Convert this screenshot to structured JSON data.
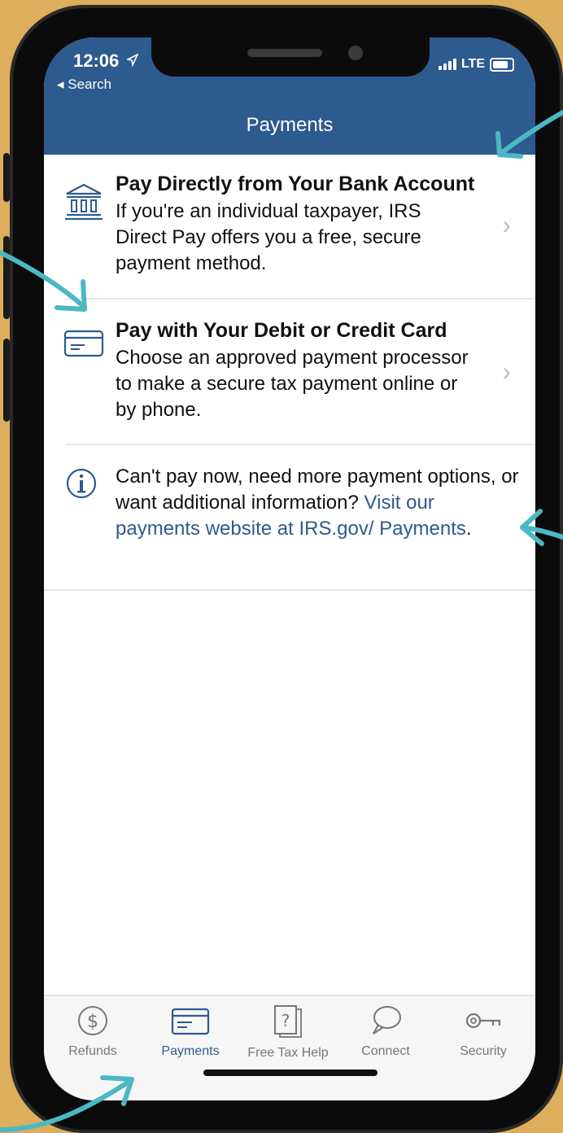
{
  "status_bar": {
    "time": "12:06",
    "location_icon": "location-arrow-icon",
    "back_label": "◂ Search",
    "network": "LTE"
  },
  "header": {
    "title": "Payments"
  },
  "rows": [
    {
      "icon": "bank-icon",
      "title": "Pay Directly from Your Bank Account",
      "description": "If you're an individual taxpayer, IRS Direct Pay offers you a free, secure payment method."
    },
    {
      "icon": "credit-card-icon",
      "title": "Pay with Your Debit or Credit Card",
      "description": "Choose an approved payment processor to make a secure tax payment online or by phone."
    }
  ],
  "info": {
    "icon": "info-icon",
    "text": "Can't pay now, need more payment options, or want additional information?",
    "link": "Visit our payments website at IRS.gov/ Payments",
    "suffix": "."
  },
  "tabs": [
    {
      "label": "Refunds",
      "icon": "dollar-circle-icon",
      "active": false
    },
    {
      "label": "Payments",
      "icon": "card-icon",
      "active": true
    },
    {
      "label": "Free Tax Help",
      "icon": "question-doc-icon",
      "active": false
    },
    {
      "label": "Connect",
      "icon": "chat-bubble-icon",
      "active": false
    },
    {
      "label": "Security",
      "icon": "key-icon",
      "active": false
    }
  ],
  "colors": {
    "nav_blue": "#2D5A8F",
    "background": "#DDAE5B",
    "annotation_arrow": "#4BB8C4"
  }
}
